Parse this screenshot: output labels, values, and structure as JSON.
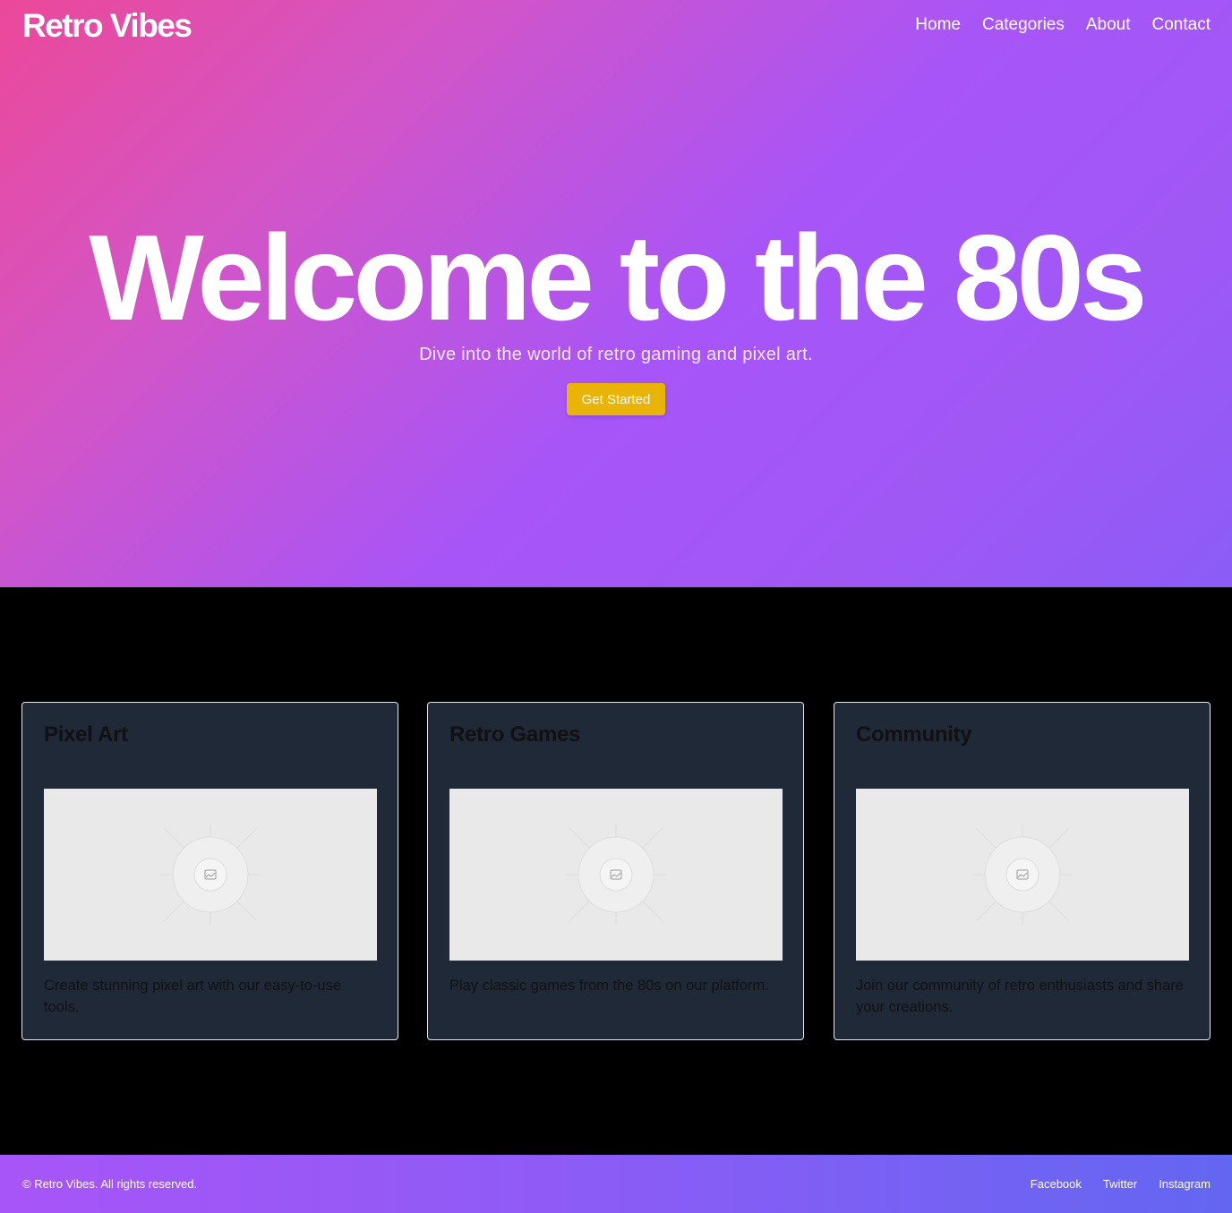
{
  "header": {
    "brand": "Retro Vibes",
    "nav": [
      "Home",
      "Categories",
      "About",
      "Contact"
    ]
  },
  "hero": {
    "title": "Welcome to the 80s",
    "subtitle": "Dive into the world of retro gaming and pixel art.",
    "cta_label": "Get Started"
  },
  "cards": [
    {
      "title": "Pixel Art",
      "image_icon": "image-placeholder-icon",
      "description": "Create stunning pixel art with our easy-to-use tools."
    },
    {
      "title": "Retro Games",
      "image_icon": "image-placeholder-icon",
      "description": "Play classic games from the 80s on our platform."
    },
    {
      "title": "Community",
      "image_icon": "image-placeholder-icon",
      "description": "Join our community of retro enthusiasts and share your creations."
    }
  ],
  "footer": {
    "copyright": "© Retro Vibes. All rights reserved.",
    "social": [
      "Facebook",
      "Twitter",
      "Instagram"
    ]
  },
  "colors": {
    "hero_gradient_start": "#ec4899",
    "hero_gradient_mid": "#a855f7",
    "hero_gradient_end": "#8b5cf6",
    "cta": "#eab308",
    "card_bg": "#1f2937",
    "footer_gradient_start": "#a855f7",
    "footer_gradient_end": "#6366f1"
  }
}
